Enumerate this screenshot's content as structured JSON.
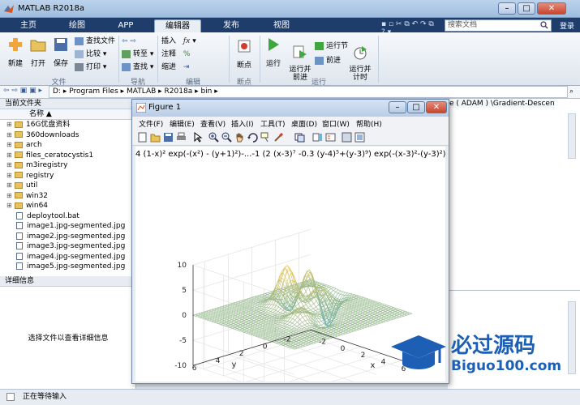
{
  "window": {
    "title": "MATLAB R2018a",
    "min": "–",
    "max": "□",
    "close": "✕"
  },
  "tabs": [
    "主页",
    "绘图",
    "APP",
    "编辑器",
    "发布",
    "视图"
  ],
  "active_tab": "编辑器",
  "search": {
    "placeholder": "搜索文档",
    "sign_in": "登录"
  },
  "ribbon": {
    "file": {
      "new": "新建",
      "open": "打开",
      "save": "保存",
      "find_files": "查找文件",
      "compare": "比较",
      "print": "打印",
      "group": "文件"
    },
    "nav": {
      "goto": "转至",
      "find": "查找",
      "group": "导航"
    },
    "edit": {
      "insert": "插入",
      "comment": "注释",
      "indent": "缩进",
      "group": "编辑"
    },
    "breakpoints": {
      "label": "断点",
      "group": "断点"
    },
    "run": {
      "run": "运行",
      "run_advance": "运行并\n前进",
      "run_section": "运行节",
      "advance": "前进",
      "run_time": "运行并\n计时",
      "group": "运行"
    }
  },
  "address": {
    "path": "D:  ▸  Program Files  ▸  MATLAB  ▸  R2018a  ▸  bin  ▸"
  },
  "current_folder": {
    "header": "当前文件夹",
    "column": "名称 ▲",
    "items": [
      {
        "name": "16G优盘资料",
        "type": "folder"
      },
      {
        "name": "360downloads",
        "type": "folder"
      },
      {
        "name": "arch",
        "type": "folder"
      },
      {
        "name": "files_ceratocystis1",
        "type": "folder"
      },
      {
        "name": "m3iregistry",
        "type": "folder"
      },
      {
        "name": "registry",
        "type": "folder"
      },
      {
        "name": "util",
        "type": "folder"
      },
      {
        "name": "win32",
        "type": "folder"
      },
      {
        "name": "win64",
        "type": "folder"
      },
      {
        "name": "deploytool.bat",
        "type": "file"
      },
      {
        "name": "image1.jpg-segmented.jpg",
        "type": "file"
      },
      {
        "name": "image2.jpg-segmented.jpg",
        "type": "file"
      },
      {
        "name": "image3.jpg-segmented.jpg",
        "type": "file"
      },
      {
        "name": "image4.jpg-segmented.jpg",
        "type": "file"
      },
      {
        "name": "image5.jpg-segmented.jpg",
        "type": "file"
      }
    ]
  },
  "details": {
    "header": "详细信息",
    "message": "选择文件以查看详细信息"
  },
  "right_panel": {
    "path_text": "e ( ADAM ) \\Gradient-Descent-"
  },
  "figure": {
    "title": "Figure 1",
    "menus": [
      "文件(F)",
      "编辑(E)",
      "查看(V)",
      "插入(I)",
      "工具(T)",
      "桌面(D)",
      "窗口(W)",
      "帮助(H)"
    ],
    "plot_title": "4 (1-x)² exp(-(x²) - (y+1)²)-...-1 (2 (x-3)⁷ -0.3 (y-4)⁵+(y-3)⁹) exp(-(x-3)²-(y-3)²)",
    "z_ticks": [
      "10",
      "5",
      "0",
      "-5",
      "-10"
    ],
    "y_ticks": [
      "6",
      "4",
      "2",
      "0",
      "-2"
    ],
    "x_ticks": [
      "-2",
      "0",
      "2",
      "4",
      "6"
    ],
    "xlabel": "x",
    "ylabel": "y"
  },
  "status": {
    "text": "正在等待输入"
  },
  "watermark": {
    "text_cn": "必过源码",
    "text_en": "Biguo100.com"
  },
  "colors": {
    "tab_bar": "#1f3d6b",
    "mesh_low": "#3aa7c9",
    "mesh_high": "#f0c060"
  }
}
